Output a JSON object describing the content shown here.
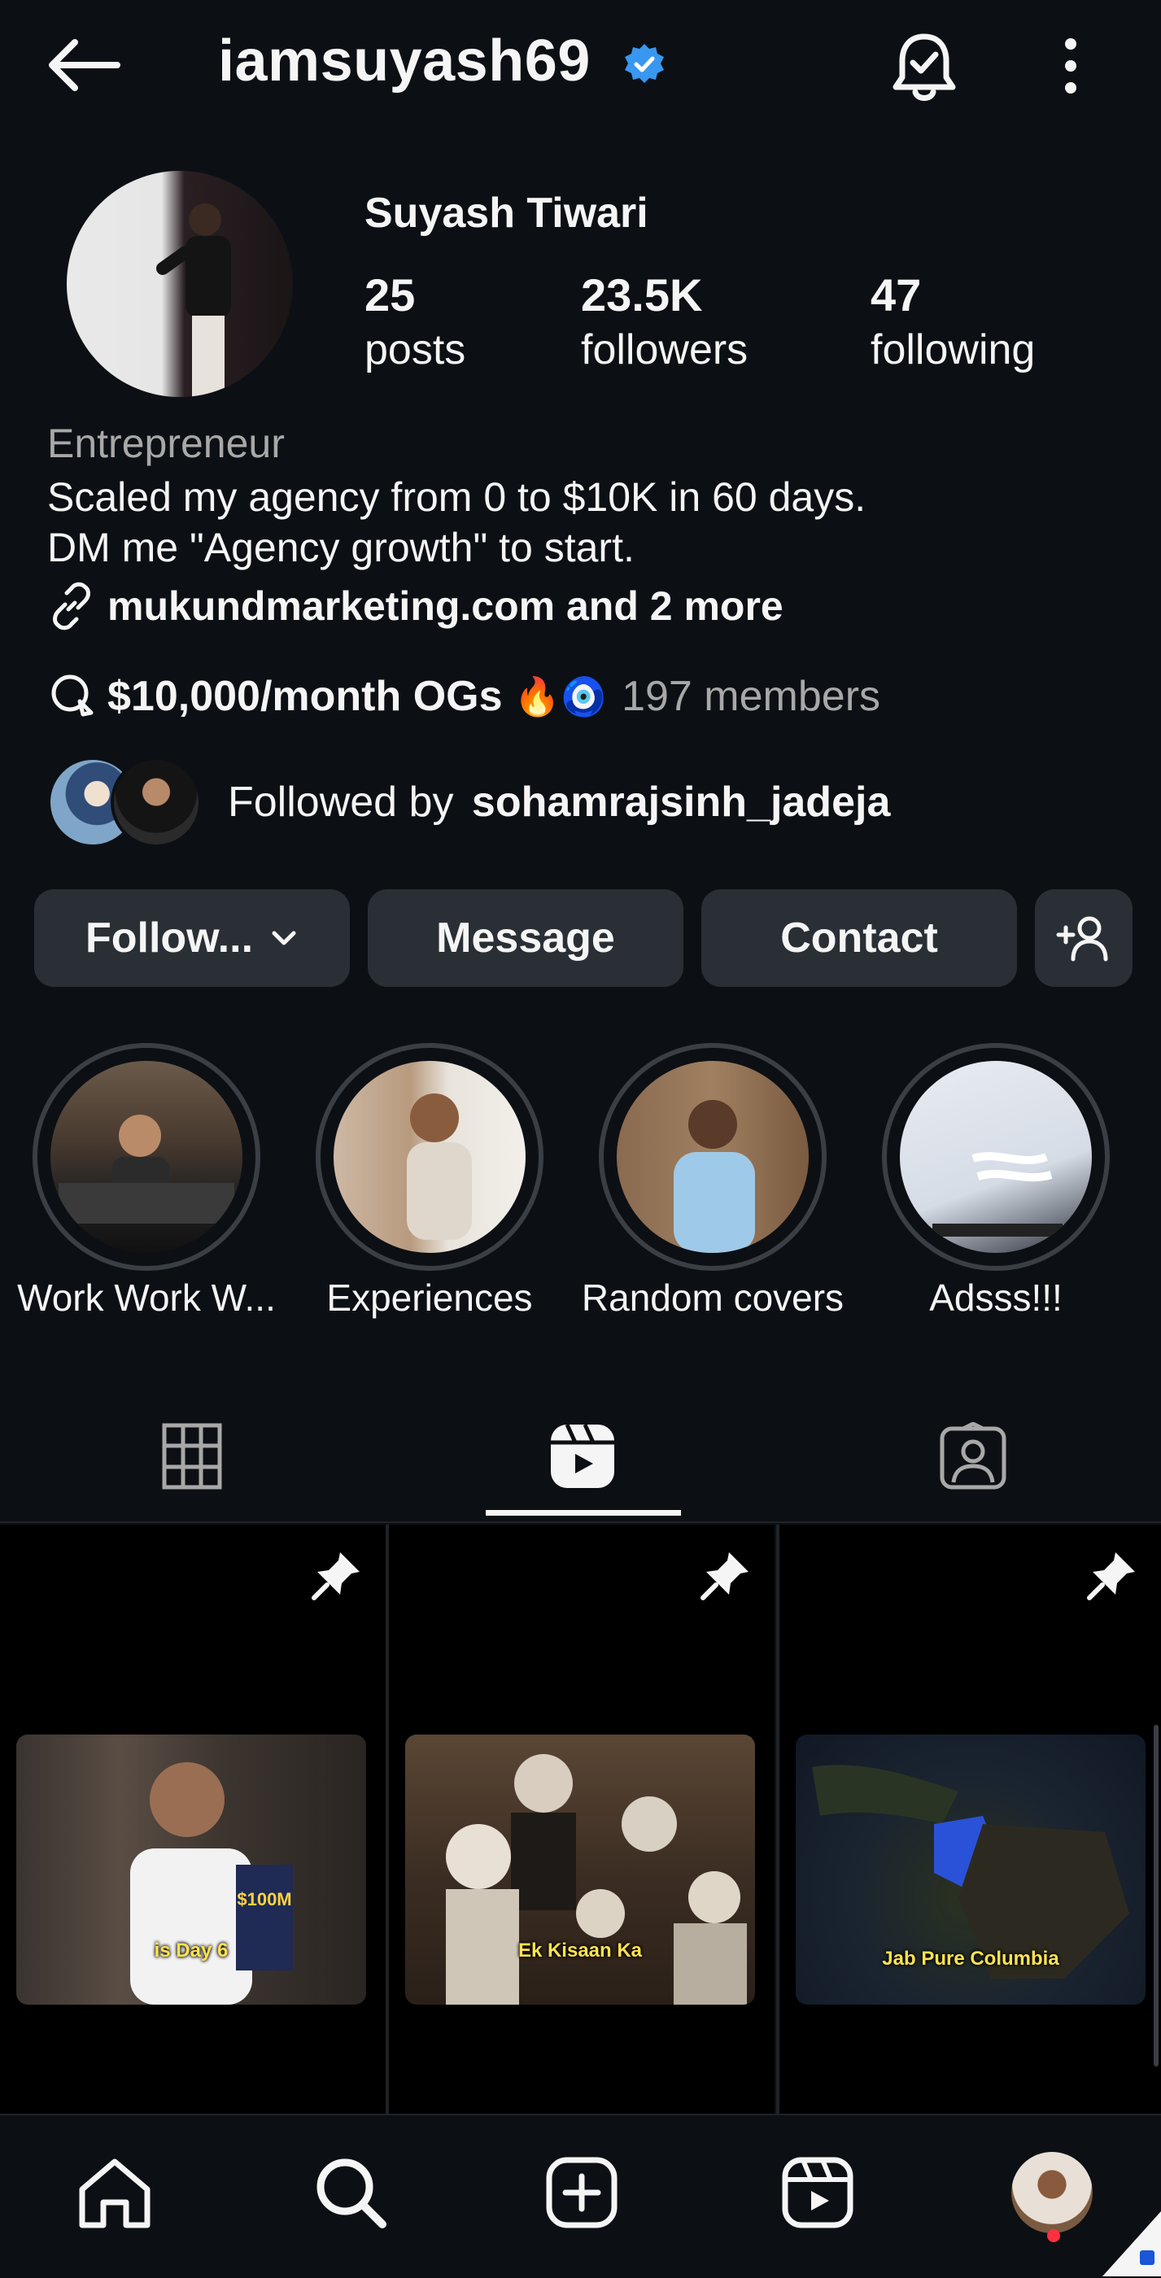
{
  "header": {
    "username": "iamsuyash69",
    "back_icon": "arrow-left-icon",
    "bell_icon": "notification-bell-icon",
    "more_icon": "more-vertical-icon",
    "verified_icon": "verified-badge-icon",
    "verified_color": "#3897f0"
  },
  "profile": {
    "display_name": "Suyash Tiwari",
    "stats": {
      "posts_count": "25",
      "posts_label": "posts",
      "followers_count": "23.5K",
      "followers_label": "followers",
      "following_count": "47",
      "following_label": "following"
    },
    "category": "Entrepreneur",
    "bio_line1": "Scaled my agency from 0 to $10K in 60 days.",
    "bio_line2": "DM me \"Agency growth\" to start.",
    "link_text": "mukundmarketing.com and 2 more",
    "channel_name": "$10,000/month OGs",
    "channel_emoji": "🔥🧿",
    "channel_members": "197 members",
    "followed_by_prefix": "Followed by",
    "followed_by_user": "sohamrajsinh_jadeja"
  },
  "actions": {
    "follow_label": "Follow...",
    "message_label": "Message",
    "contact_label": "Contact",
    "add_user_icon": "add-user-icon"
  },
  "highlights": [
    {
      "label": "Work Work W..."
    },
    {
      "label": "Experiences"
    },
    {
      "label": "Random covers"
    },
    {
      "label": "Adsss!!!"
    }
  ],
  "tabs": [
    {
      "name": "grid",
      "icon": "grid-icon"
    },
    {
      "name": "reels",
      "icon": "reels-icon",
      "active": true
    },
    {
      "name": "tagged",
      "icon": "tagged-icon"
    }
  ],
  "posts": [
    {
      "caption": "is Day 6",
      "pinned": true
    },
    {
      "caption": "Ek Kisaan Ka",
      "pinned": true
    },
    {
      "caption": "Jab Pure Columbia",
      "pinned": true
    }
  ],
  "bottom_nav": [
    {
      "icon": "home-icon"
    },
    {
      "icon": "search-icon"
    },
    {
      "icon": "create-icon"
    },
    {
      "icon": "reels-icon"
    },
    {
      "icon": "profile-avatar"
    }
  ]
}
